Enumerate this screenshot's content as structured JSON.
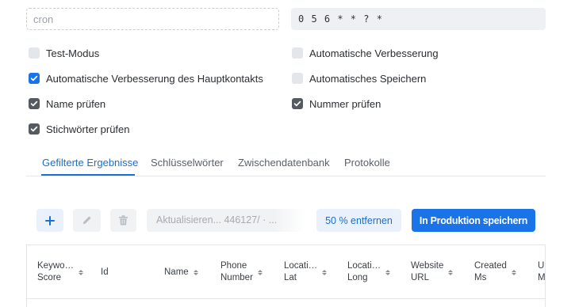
{
  "cron": {
    "placeholder": "cron",
    "value": ""
  },
  "pattern": {
    "value": "0 5 6 * * ? *"
  },
  "checkboxes": [
    {
      "label": "Test-Modus",
      "checked": false,
      "style": "off"
    },
    {
      "label": "Automatische Verbesserung",
      "checked": false,
      "style": "off"
    },
    {
      "label": "Automatische Verbesserung des Hauptkontakts",
      "checked": true,
      "style": "blue"
    },
    {
      "label": "Automatisches Speichern",
      "checked": false,
      "style": "off"
    },
    {
      "label": "Name prüfen",
      "checked": true,
      "style": "grey"
    },
    {
      "label": "Nummer prüfen",
      "checked": true,
      "style": "grey"
    },
    {
      "label": "Stichwörter prüfen",
      "checked": true,
      "style": "grey"
    }
  ],
  "tabs": [
    {
      "label": "Gefilterte Ergebnisse",
      "active": true
    },
    {
      "label": "Schlüsselwörter",
      "active": false
    },
    {
      "label": "Zwischendatenbank",
      "active": false
    },
    {
      "label": "Protokolle",
      "active": false
    }
  ],
  "toolbar": {
    "add_icon": "plus-icon",
    "edit_icon": "pencil-icon",
    "delete_icon": "trash-icon",
    "status_text": "Aktualisieren... 446127/ · ...",
    "remove_label": "50 % entfernen",
    "save_label": "In Produktion speichern"
  },
  "table": {
    "columns": [
      {
        "label": "Keyword\nScore",
        "display": "Keywo…\nScore",
        "sortable": true
      },
      {
        "label": "Id",
        "display": "Id",
        "sortable": false
      },
      {
        "label": "Name",
        "display": "Name",
        "sortable": true
      },
      {
        "label": "Phone\nNumber",
        "display": "Phone\nNumber",
        "sortable": true
      },
      {
        "label": "Location\nLat",
        "display": "Locati…\nLat",
        "sortable": true
      },
      {
        "label": "Location\nLong",
        "display": "Locati…\nLong",
        "sortable": true
      },
      {
        "label": "Website\nURL",
        "display": "Website\nURL",
        "sortable": true
      },
      {
        "label": "Created\nMs",
        "display": "Created\nMs",
        "sortable": true
      },
      {
        "label": "Updated\nMs",
        "display": "Up\nM",
        "sortable": false
      }
    ]
  },
  "colors": {
    "accent": "#1a73e8",
    "tab_active": "#1a6fd1",
    "checkbox_grey": "#555a61"
  }
}
